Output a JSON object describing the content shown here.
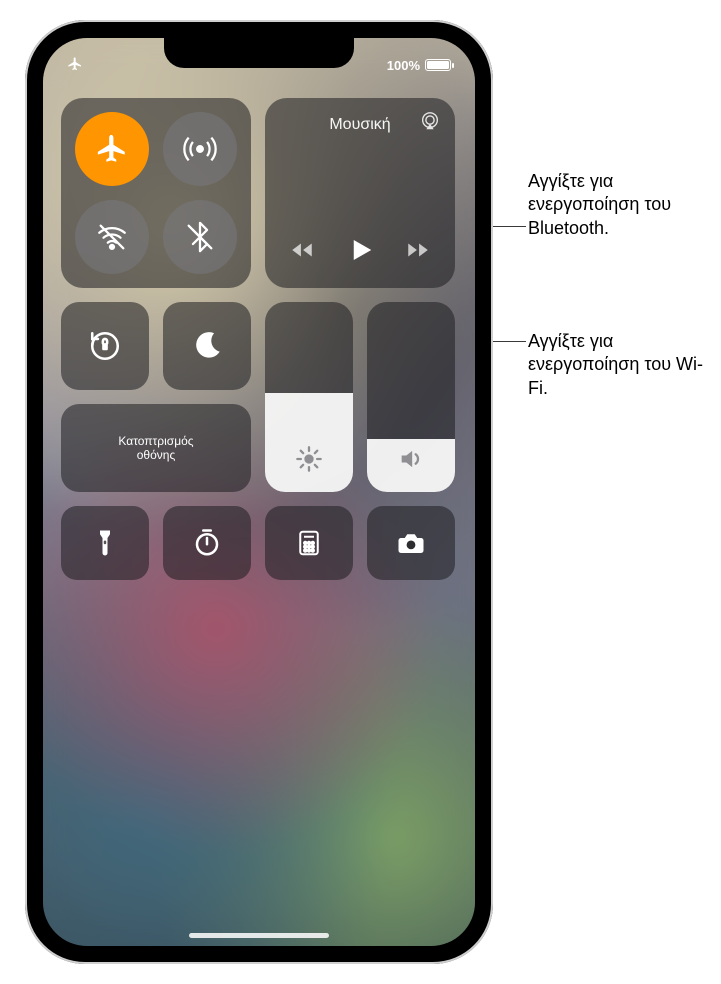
{
  "statusbar": {
    "battery_text": "100%"
  },
  "connectivity": {
    "airplane": {
      "name": "airplane-mode",
      "active": true
    },
    "cellular": {
      "name": "cellular-data"
    },
    "wifi": {
      "name": "wifi-off"
    },
    "bluetooth": {
      "name": "bluetooth-off"
    }
  },
  "music": {
    "title": "Μουσική"
  },
  "screen_mirroring": {
    "line1": "Κατοπτρισμός",
    "line2": "οθόνης"
  },
  "sliders": {
    "brightness_pct": 52,
    "volume_pct": 28
  },
  "callouts": {
    "bluetooth": "Αγγίξτε για ενεργοποίηση του Bluetooth.",
    "wifi": "Αγγίξτε για ενεργοποίηση του Wi-Fi."
  },
  "colors": {
    "active_orange": "#ff9500"
  }
}
